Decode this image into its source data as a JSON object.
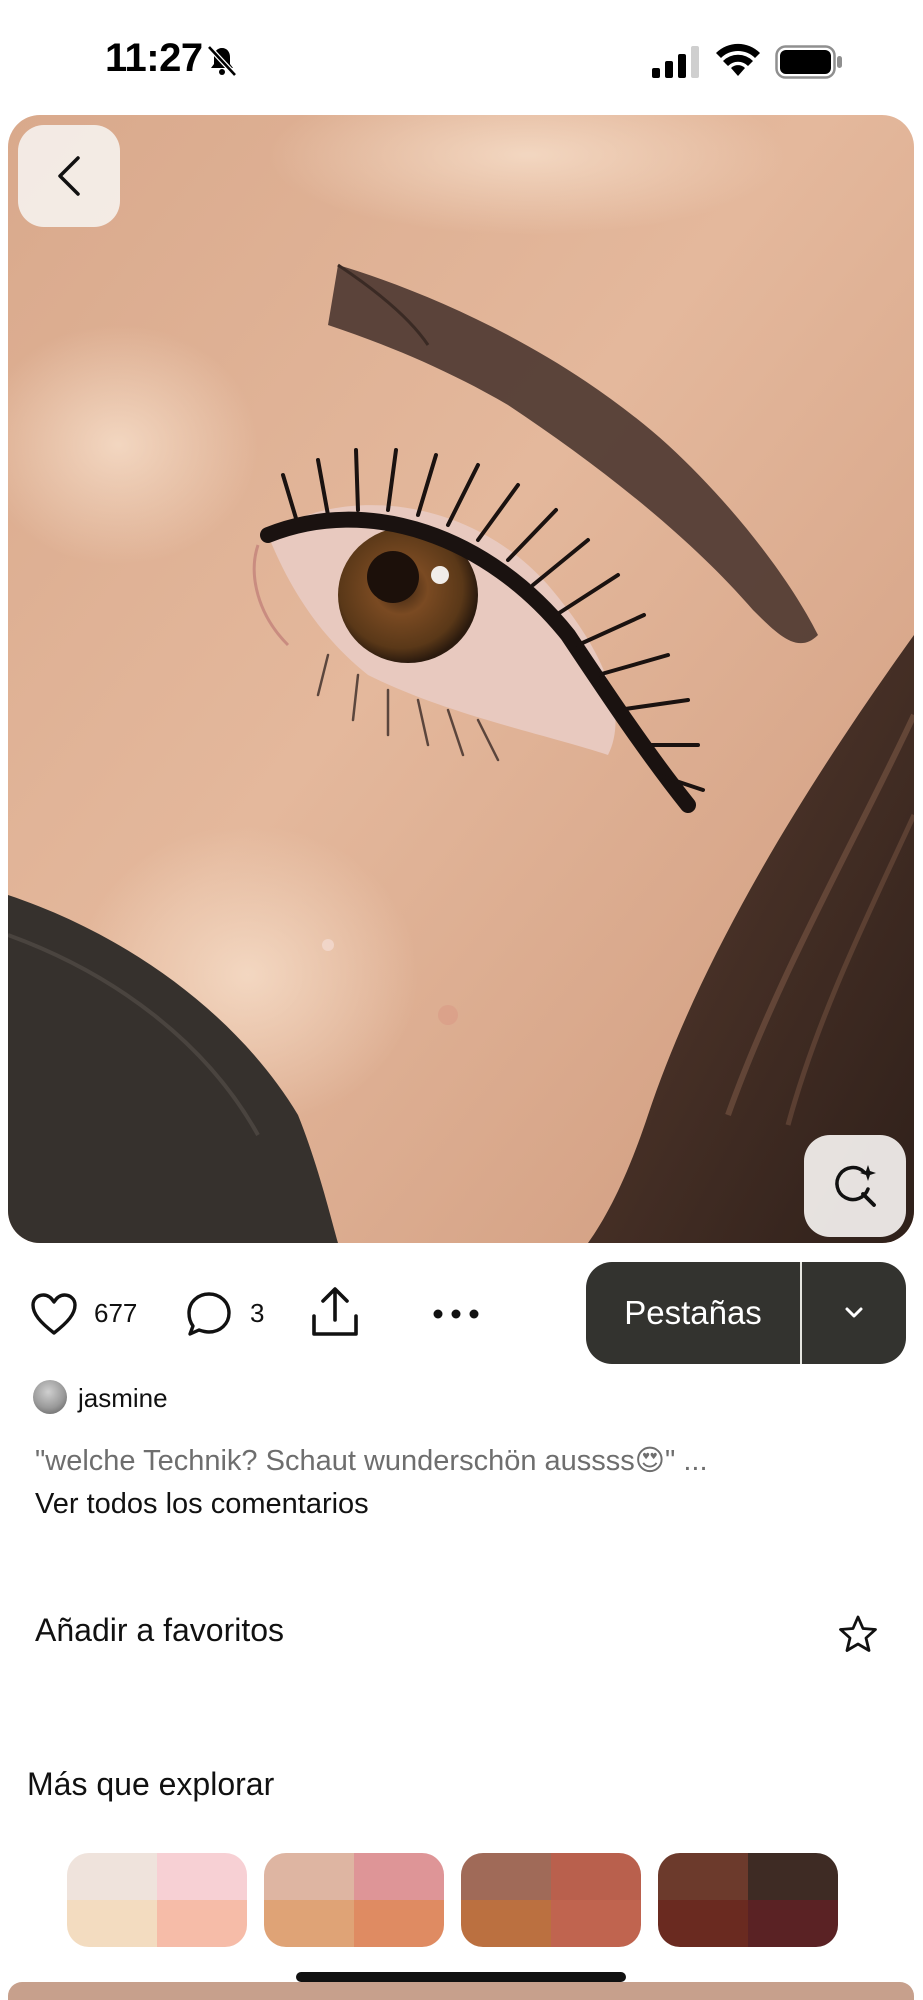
{
  "status_bar": {
    "time": "11:27"
  },
  "pin": {
    "like_count": "677",
    "comment_count": "3",
    "board_label": "Pestañas"
  },
  "author": {
    "name": "jasmine"
  },
  "comment": {
    "text": "\"welche Technik? Schaut wunderschön aussss😍\" ...",
    "view_all_label": "Ver todos los comentarios"
  },
  "favorite": {
    "label": "Añadir a favoritos"
  },
  "explore": {
    "title": "Más que explorar",
    "palettes": [
      {
        "colors": [
          "#efe3dc",
          "#f7d0d4",
          "#f3dcc0",
          "#f6bca8"
        ]
      },
      {
        "colors": [
          "#deb5a2",
          "#de9597",
          "#dfa376",
          "#df8b62"
        ]
      },
      {
        "colors": [
          "#a06a58",
          "#b9604d",
          "#bb7040",
          "#c0644f"
        ]
      },
      {
        "colors": [
          "#6c3a2c",
          "#3e2b24",
          "#6a2a20",
          "#5a2224"
        ]
      }
    ]
  },
  "icons": {
    "bell": "bell-slash-icon",
    "signal": "cellular-signal-icon",
    "wifi": "wifi-icon",
    "battery": "battery-icon",
    "back": "chevron-left-icon",
    "visual_search": "visual-search-icon",
    "like": "heart-icon",
    "comment": "comment-bubble-icon",
    "share": "share-icon",
    "more": "more-dots-icon",
    "dropdown": "chevron-down-icon",
    "favorite": "star-icon"
  }
}
